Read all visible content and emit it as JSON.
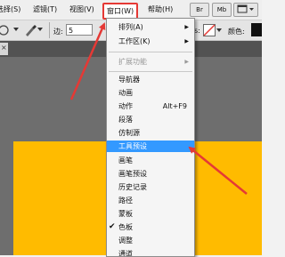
{
  "menubar": {
    "items": [
      "选择(S)",
      "滤镜(T)",
      "视图(V)",
      "窗口(W)",
      "帮助(H)"
    ],
    "app_buttons": [
      "Br",
      "Mb"
    ]
  },
  "options_bar": {
    "edge_label": "边:",
    "edge_value": "5",
    "color_label": "颜色:"
  },
  "window_menu": {
    "items": [
      {
        "label": "排列(A)",
        "submenu": true
      },
      {
        "label": "工作区(K)",
        "submenu": true
      },
      {
        "label": "扩展功能",
        "submenu": true,
        "disabled": true
      },
      {
        "label": "导航器"
      },
      {
        "label": "动画"
      },
      {
        "label": "动作",
        "shortcut": "Alt+F9"
      },
      {
        "label": "段落"
      },
      {
        "label": "仿制源"
      },
      {
        "label": "工具预设",
        "highlighted": true
      },
      {
        "label": "画笔"
      },
      {
        "label": "画笔预设"
      },
      {
        "label": "历史记录"
      },
      {
        "label": "路径"
      },
      {
        "label": "蒙板"
      },
      {
        "label": "色板",
        "checked": true
      },
      {
        "label": "调整"
      },
      {
        "label": "通道"
      }
    ]
  },
  "accent_colors": {
    "annotation": "#e53935",
    "highlight": "#3399ff",
    "document": "#ffbb00"
  }
}
